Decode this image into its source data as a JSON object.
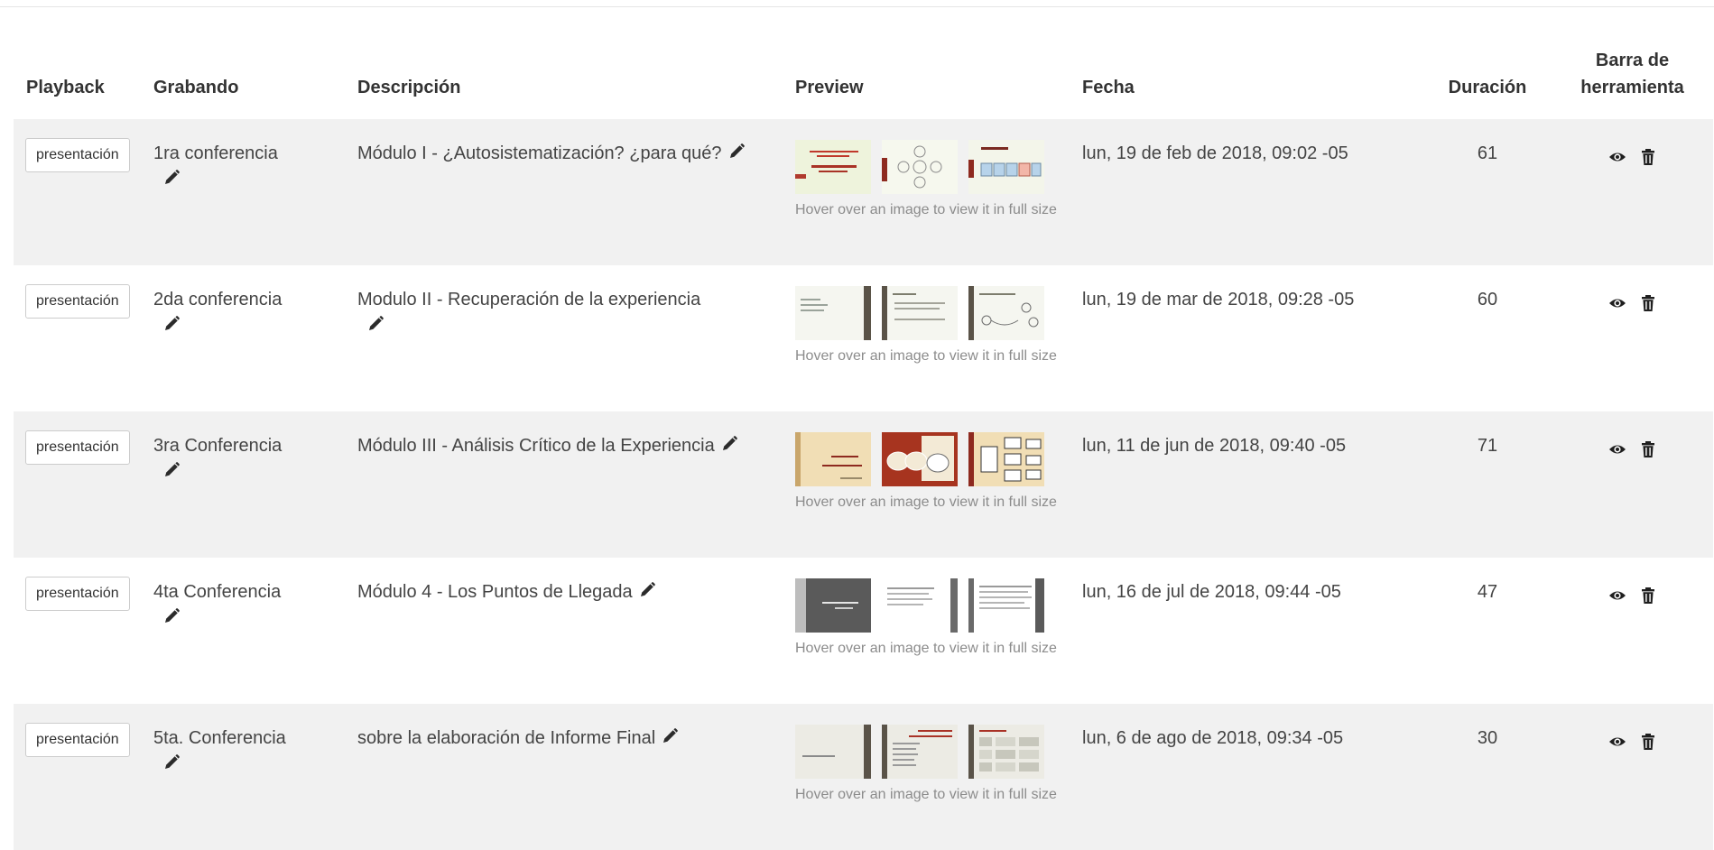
{
  "columns": {
    "playback": "Playback",
    "grabando": "Grabando",
    "descripcion": "Descripción",
    "preview": "Preview",
    "fecha": "Fecha",
    "duracion": "Duración",
    "barra": "Barra de herramienta"
  },
  "preview_note": "Hover over an image to view it in full size",
  "colors": {
    "row_stripe": "#f1f1f1",
    "header_text": "#333333",
    "muted_text": "#8c8c8c"
  },
  "rows": [
    {
      "playback": "presentación",
      "grabando": "1ra conferencia",
      "descripcion": "Módulo I - ¿Autosistematización? ¿para qué?",
      "fecha": "lun, 19 de feb de 2018, 09:02 -05",
      "duracion": "61",
      "toolbar": [
        "eye-icon",
        "trash-icon"
      ]
    },
    {
      "playback": "presentación",
      "grabando": "2da conferencia",
      "descripcion": "Modulo II - Recuperación de la experiencia",
      "fecha": "lun, 19 de mar de 2018, 09:28 -05",
      "duracion": "60",
      "toolbar": [
        "eye-icon",
        "trash-icon"
      ]
    },
    {
      "playback": "presentación",
      "grabando": "3ra Conferencia",
      "descripcion": "Módulo III - Análisis Crítico de la Experiencia",
      "fecha": "lun, 11 de jun de 2018, 09:40 -05",
      "duracion": "71",
      "toolbar": [
        "eye-icon",
        "trash-icon"
      ]
    },
    {
      "playback": "presentación",
      "grabando": "4ta Conferencia",
      "descripcion": "Módulo 4 - Los Puntos de Llegada",
      "fecha": "lun, 16 de jul de 2018, 09:44 -05",
      "duracion": "47",
      "toolbar": [
        "eye-icon",
        "trash-icon"
      ]
    },
    {
      "playback": "presentación",
      "grabando": "5ta. Conferencia",
      "descripcion": "sobre la elaboración de Informe Final",
      "fecha": "lun, 6 de ago de 2018, 09:34 -05",
      "duracion": "30",
      "toolbar": [
        "eye-icon",
        "trash-icon"
      ]
    }
  ]
}
